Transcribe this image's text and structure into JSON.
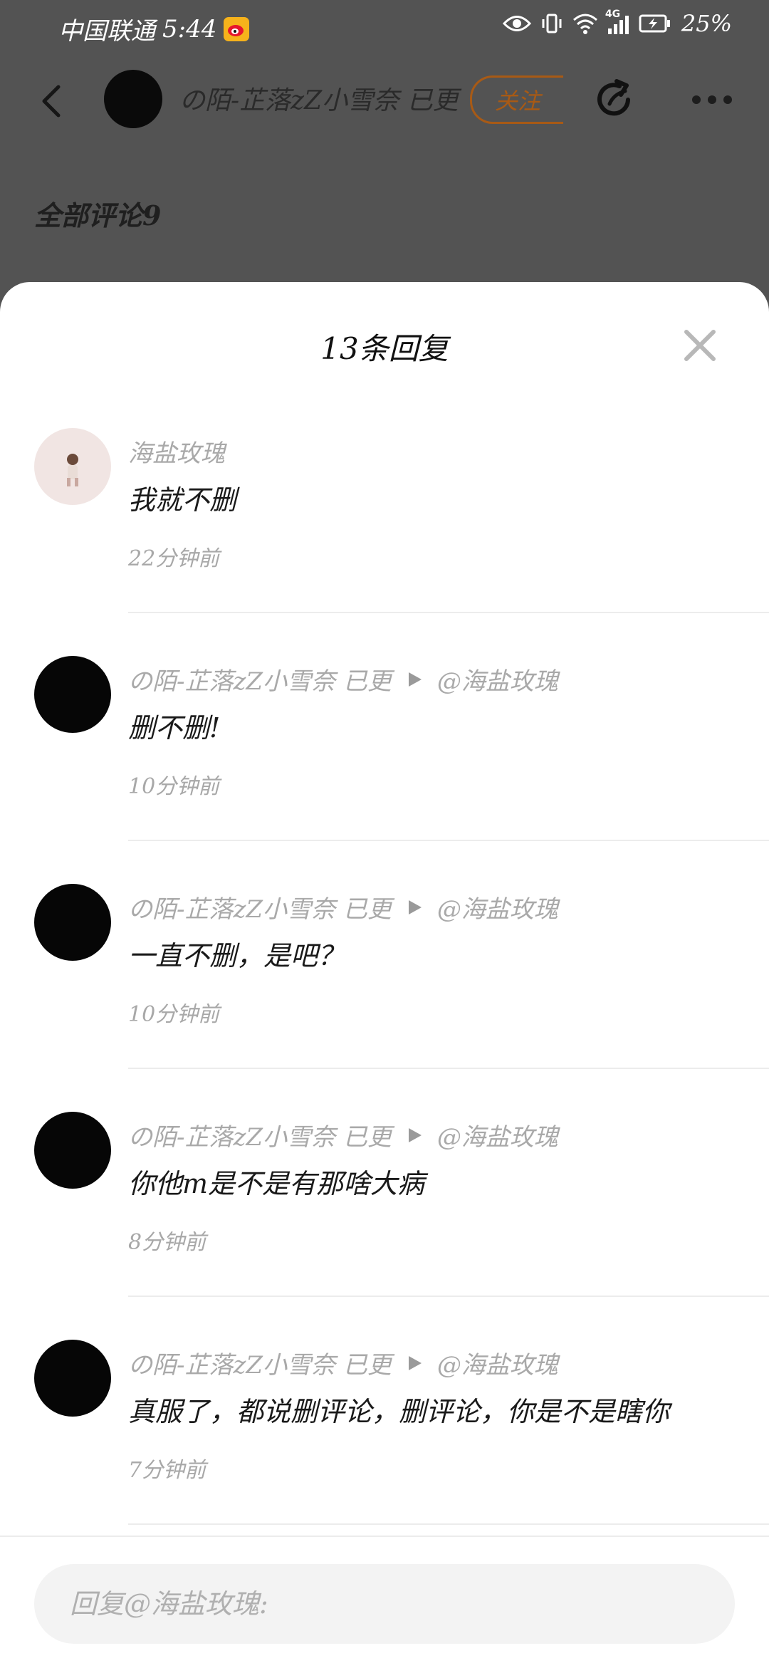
{
  "status_bar": {
    "carrier": "中国联通",
    "time": "5:44",
    "network": "4G",
    "battery": "25%"
  },
  "header": {
    "username": "の陌-芷落zZ小雪奈 已更",
    "follow_label": "关注",
    "all_comments": "全部评论9"
  },
  "sheet": {
    "title": "13条回复",
    "input_placeholder": "回复@海盐玫瑰:"
  },
  "replies": [
    {
      "author": "海盐玫瑰",
      "reply_to": "",
      "text": "我就不删",
      "time": "22分钟前"
    },
    {
      "author": "の陌-芷落zZ小雪奈 已更",
      "reply_to": "@海盐玫瑰",
      "text": "删不删!",
      "time": "10分钟前"
    },
    {
      "author": "の陌-芷落zZ小雪奈 已更",
      "reply_to": "@海盐玫瑰",
      "text": "一直不删，是吧？",
      "time": "10分钟前"
    },
    {
      "author": "の陌-芷落zZ小雪奈 已更",
      "reply_to": "@海盐玫瑰",
      "text": "你他m是不是有那啥大病",
      "time": "8分钟前"
    },
    {
      "author": "の陌-芷落zZ小雪奈 已更",
      "reply_to": "@海盐玫瑰",
      "text": "真服了，都说删评论，删评论，你是不是瞎你",
      "time": "7分钟前"
    }
  ],
  "icons": {
    "back": "chevron-left-icon",
    "share": "share-icon",
    "more": "more-icon",
    "close": "close-icon"
  },
  "colors": {
    "follow": "#a85a15",
    "overlay": "#535353"
  }
}
